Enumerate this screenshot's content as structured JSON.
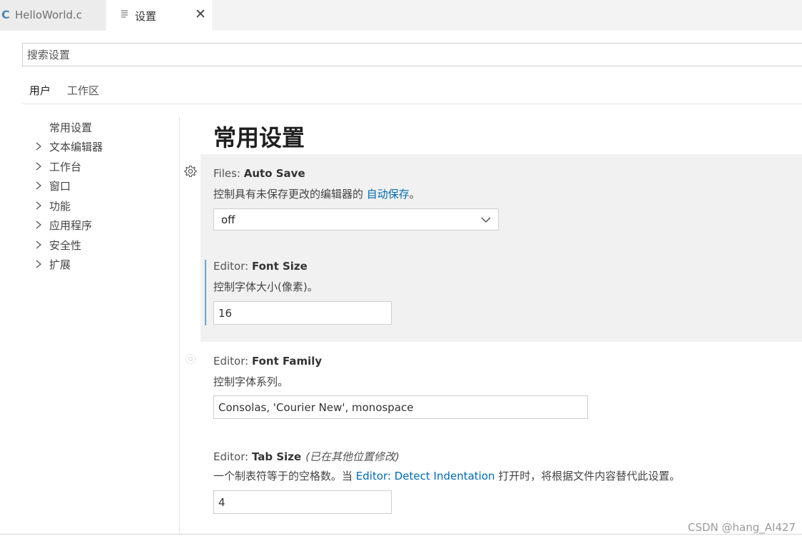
{
  "tabs": [
    {
      "label": "HelloWorld.c",
      "icon": "c-file-icon"
    },
    {
      "label": "设置",
      "icon": "settings-file-icon"
    }
  ],
  "search": {
    "placeholder": "搜索设置"
  },
  "scopes": [
    {
      "label": "用户"
    },
    {
      "label": "工作区"
    }
  ],
  "toc": [
    {
      "label": "常用设置"
    },
    {
      "label": "文本编辑器"
    },
    {
      "label": "工作台"
    },
    {
      "label": "窗口"
    },
    {
      "label": "功能"
    },
    {
      "label": "应用程序"
    },
    {
      "label": "安全性"
    },
    {
      "label": "扩展"
    }
  ],
  "main": {
    "title": "常用设置",
    "settings": [
      {
        "category": "Files: ",
        "name": "Auto Save",
        "desc_prefix": "控制具有未保存更改的编辑器的 ",
        "desc_link": "自动保存",
        "desc_suffix": "。",
        "value": "off"
      },
      {
        "category": "Editor: ",
        "name": "Font Size",
        "desc": "控制字体大小(像素)。",
        "value": "16"
      },
      {
        "category": "Editor: ",
        "name": "Font Family",
        "desc": "控制字体系列。",
        "value": "Consolas, 'Courier New', monospace"
      },
      {
        "category": "Editor: ",
        "name": "Tab Size",
        "modified": "(已在其他位置修改)",
        "desc_prefix": "一个制表符等于的空格数。当 ",
        "desc_link": "Editor: Detect Indentation",
        "desc_suffix": " 打开时，将根据文件内容替代此设置。",
        "value": "4"
      }
    ]
  },
  "watermark": "CSDN @hang_AI427",
  "colors": {
    "accent": "#006ab1",
    "focus_bar": "#6aa4cf",
    "c_icon": "#4f85b5"
  }
}
